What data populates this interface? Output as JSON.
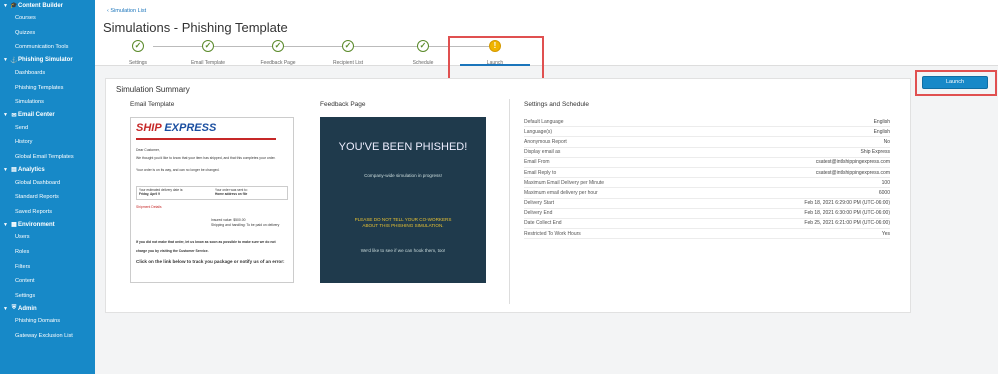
{
  "sidebar": {
    "sections": [
      {
        "label": "Content Builder",
        "icon": "graduation-cap-icon",
        "items": [
          "Courses",
          "Quizzes",
          "Communication Tools"
        ]
      },
      {
        "label": "Phishing Simulator",
        "icon": "hook-icon",
        "items": [
          "Dashboards",
          "Phishing Templates",
          "Simulations"
        ]
      },
      {
        "label": "Email Center",
        "icon": "envelope-icon",
        "items": [
          "Send",
          "History",
          "Global Email Templates"
        ]
      },
      {
        "label": "Analytics",
        "icon": "chart-icon",
        "items": [
          "Global Dashboard",
          "Standard Reports",
          "Saved Reports"
        ]
      },
      {
        "label": "Environment",
        "icon": "grid-icon",
        "items": [
          "Users",
          "Roles",
          "Filters",
          "Content",
          "Settings"
        ]
      },
      {
        "label": "Admin",
        "icon": "shield-icon",
        "items": [
          "Phishing Domains",
          "Gateway Exclusion List"
        ]
      }
    ]
  },
  "header": {
    "back_link": "Simulation List",
    "title": "Simulations - Phishing Template"
  },
  "steps": [
    {
      "label": "Settings",
      "status": "complete"
    },
    {
      "label": "Email Template",
      "status": "complete"
    },
    {
      "label": "Feedback Page",
      "status": "complete"
    },
    {
      "label": "Recipient List",
      "status": "complete"
    },
    {
      "label": "Schedule",
      "status": "complete"
    },
    {
      "label": "Launch",
      "status": "warning"
    }
  ],
  "summary": {
    "title": "Simulation Summary",
    "email_template_title": "Email Template",
    "feedback_page_title": "Feedback Page",
    "settings_title": "Settings and Schedule"
  },
  "email_preview": {
    "logo_ship": "SHIP",
    "logo_express": "EXPRESS",
    "greeting": "Dear Customer,",
    "line1": "We thought you'd like to know that your item has shipped, and that this completes your order.",
    "line2": "Your order is on its way, and can no longer be changed.",
    "box_left": "Your estimated delivery date is:",
    "box_left_value": "Friday, April 9",
    "box_right": "Your order was sent to:",
    "box_right_value": "Home address on file",
    "shipment_details": "Shipment Details",
    "invoice": "Insured value: $500.00",
    "shipping": "Shipping and handling: To be paid on delivery",
    "notice": "If you did not make that order, let us know as soon as possible to make sure we do not",
    "notice2": "charge you by visiting the Customer Service.",
    "click": "Click on the link below to track you package or notify us of an error:"
  },
  "feedback_preview": {
    "heading": "YOU'VE BEEN PHISHED!",
    "subtitle": "Company-wide simulation in progress!",
    "warning": "PLEASE DO NOT TELL YOUR CO-WORKERS ABOUT THIS PHISHING SIMULATION.",
    "footer": "We'd like to see if we can hook them, too!"
  },
  "settings": [
    {
      "label": "Default Language",
      "value": "English"
    },
    {
      "label": "Language(s)",
      "value": "English"
    },
    {
      "label": "Anonymous Report",
      "value": "No"
    },
    {
      "label": "Display email as",
      "value": "Ship Express"
    },
    {
      "label": "Email From",
      "value": "csatest@intlshippingexpress.com"
    },
    {
      "label": "Email Reply to",
      "value": "csatest@intlshippingexpress.com"
    },
    {
      "label": "Maximum Email Delivery per Minute",
      "value": "100"
    },
    {
      "label": "Maximum email delivery per hour",
      "value": "6000"
    },
    {
      "label": "Delivery Start",
      "value": "Feb 18, 2021 6:29:00 PM (UTC-06:00)"
    },
    {
      "label": "Delivery End",
      "value": "Feb 18, 2021 6:30:00 PM (UTC-06:00)"
    },
    {
      "label": "Date Collect End",
      "value": "Feb 25, 2021 6:21:00 PM (UTC-06:00)"
    },
    {
      "label": "Restricted To Work Hours",
      "value": "Yes"
    }
  ],
  "launch_button": "Launch"
}
